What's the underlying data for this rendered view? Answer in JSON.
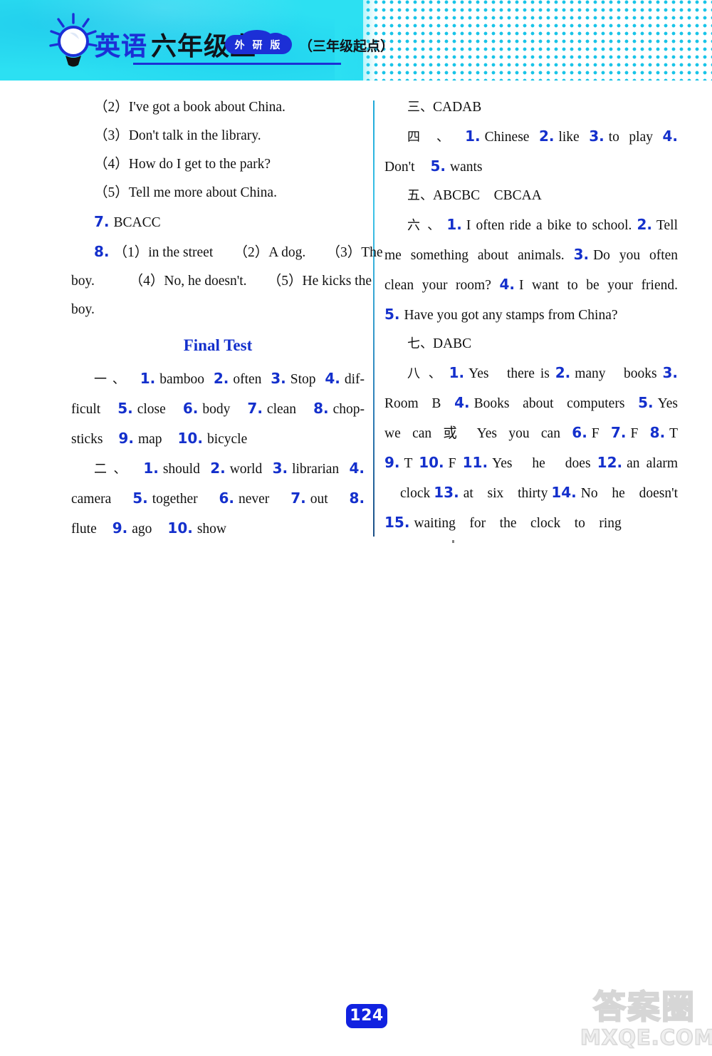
{
  "header": {
    "subject_cn": "英语",
    "grade_cn": "六年级上",
    "edition_badge": "外 研 版",
    "start_note": "（三年级起点）",
    "bulb_icon": "lightbulb-icon"
  },
  "left_column": {
    "lines": [
      "（2）I've got a book about China.",
      "（3）Don't talk in the library.",
      "（4）How do I get to the park?",
      "（5）Tell me more about China."
    ],
    "item7": {
      "num": "7.",
      "text": "BCACC"
    },
    "item8": {
      "num": "8.",
      "line1": "（1）in the street　　（2）A dog.　　（3）The",
      "line2": "boy.　　　（4）No, he doesn't.　　（5）He kicks the",
      "line3": "boy."
    },
    "final_test_title": "Final Test",
    "section1": {
      "marker": "一、",
      "items": [
        {
          "n": "1.",
          "t": "bamboo"
        },
        {
          "n": "2.",
          "t": "often"
        },
        {
          "n": "3.",
          "t": "Stop"
        },
        {
          "n": "4.",
          "t": "dif-"
        },
        {
          "n": "",
          "t": "ficult"
        },
        {
          "n": "5.",
          "t": "close"
        },
        {
          "n": "6.",
          "t": "body"
        },
        {
          "n": "7.",
          "t": "clean"
        },
        {
          "n": "8.",
          "t": "chop-"
        },
        {
          "n": "",
          "t": "sticks"
        },
        {
          "n": "9.",
          "t": "map"
        },
        {
          "n": "10.",
          "t": "bicycle"
        }
      ]
    },
    "section2": {
      "marker": "二、",
      "items": [
        {
          "n": "1.",
          "t": "should"
        },
        {
          "n": "2.",
          "t": "world"
        },
        {
          "n": "3.",
          "t": "librarian"
        },
        {
          "n": "4.",
          "t": ""
        },
        {
          "n": "",
          "t": "camera"
        },
        {
          "n": "5.",
          "t": "together"
        },
        {
          "n": "6.",
          "t": "never"
        },
        {
          "n": "7.",
          "t": "out"
        },
        {
          "n": "8.",
          "t": ""
        },
        {
          "n": "",
          "t": "flute"
        },
        {
          "n": "9.",
          "t": "ago"
        },
        {
          "n": "10.",
          "t": "show"
        }
      ]
    }
  },
  "right_column": {
    "section3": {
      "marker": "三、",
      "text": "CADAB"
    },
    "section4": {
      "marker": "四 、",
      "items": [
        {
          "n": "1.",
          "t": "Chinese"
        },
        {
          "n": "2.",
          "t": "like"
        },
        {
          "n": "3.",
          "t": "to play"
        },
        {
          "n": "4.",
          "t": ""
        },
        {
          "n": "",
          "t": "Don't"
        },
        {
          "n": "5.",
          "t": "wants"
        }
      ]
    },
    "section5": {
      "marker": "五、",
      "text": "ABCBC　CBCAA"
    },
    "section6": {
      "marker": "六 、",
      "items": [
        {
          "n": "1.",
          "t": "I often ride a bike to school."
        },
        {
          "n": "2.",
          "t": "Tell me something about animals."
        },
        {
          "n": "3.",
          "t": "Do you often clean your room?"
        },
        {
          "n": "4.",
          "t": "I want to be your friend."
        },
        {
          "n": "5.",
          "t": "Have you got any stamps from China?"
        }
      ]
    },
    "section7": {
      "marker": "七、",
      "text": "DABC"
    },
    "section8": {
      "marker": "八 、",
      "items": [
        {
          "n": "1.",
          "t": "Yes　there is"
        },
        {
          "n": "2.",
          "t": "many　books"
        },
        {
          "n": "3.",
          "t": "Room　B"
        },
        {
          "n": "4.",
          "t": "Books about computers"
        },
        {
          "n": "5.",
          "t": "Yes we　can 或 Yes　you　can"
        },
        {
          "n": "6.",
          "t": "F"
        },
        {
          "n": "7.",
          "t": "F"
        },
        {
          "n": "8.",
          "t": "T"
        },
        {
          "n": "9.",
          "t": "T"
        },
        {
          "n": "10.",
          "t": "F"
        },
        {
          "n": "11.",
          "t": "Yes　he　does"
        },
        {
          "n": "12.",
          "t": "an　alarm　clock"
        },
        {
          "n": "13.",
          "t": "at　six　thirty"
        },
        {
          "n": "14.",
          "t": "No　he　doesn't"
        },
        {
          "n": "15.",
          "t": "waiting　for　the　clock　to　ring"
        }
      ]
    }
  },
  "footer": {
    "page_number": "124",
    "watermark_cn": "答案圈",
    "watermark_en": "MXQE.COM"
  },
  "colors": {
    "banner": "#2ce0f2",
    "accent_blue": "#1430cc",
    "dot_pattern": "#19c4e8",
    "page_badge": "#1122e0"
  }
}
